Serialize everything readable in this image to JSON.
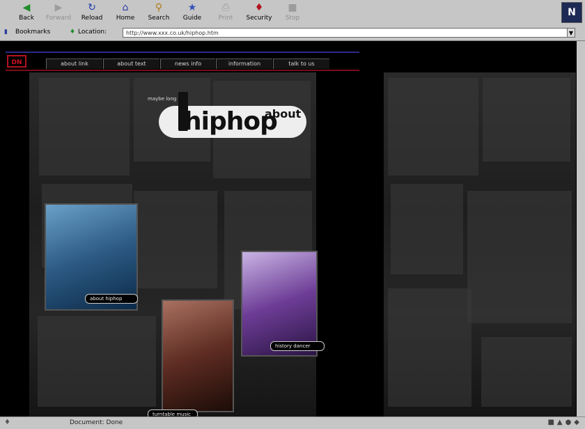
{
  "browser": {
    "toolbar": [
      {
        "name": "back-button",
        "label": "Back",
        "icon": "back-arrow-icon",
        "enabled": true
      },
      {
        "name": "forward-button",
        "label": "Forward",
        "icon": "forward-arrow-icon",
        "enabled": false
      },
      {
        "name": "reload-button",
        "label": "Reload",
        "icon": "reload-icon",
        "enabled": true
      },
      {
        "name": "home-button",
        "label": "Home",
        "icon": "home-icon",
        "enabled": true
      },
      {
        "name": "search-button",
        "label": "Search",
        "icon": "search-icon",
        "enabled": true
      },
      {
        "name": "guide-button",
        "label": "Guide",
        "icon": "guide-icon",
        "enabled": true
      },
      {
        "name": "print-button",
        "label": "Print",
        "icon": "print-icon",
        "enabled": false
      },
      {
        "name": "security-button",
        "label": "Security",
        "icon": "lock-icon",
        "enabled": true
      },
      {
        "name": "stop-button",
        "label": "Stop",
        "icon": "stop-icon",
        "enabled": false
      }
    ],
    "bookmarks_label": "Bookmarks",
    "location_label": "Location:",
    "location_value": "http://www.xxx.co.uk/hiphop.htm",
    "status_text": "Document: Done"
  },
  "site": {
    "nav_logo": "DN",
    "nav_items": [
      "about link",
      "about text",
      "news info",
      "information",
      "talk to us"
    ],
    "logo": {
      "sub": "maybe long",
      "main": "hiphop",
      "about": "about"
    },
    "photo_labels": {
      "photo1": "about hiphop",
      "photo2": "history dancer",
      "photo3": "turntable music"
    }
  }
}
